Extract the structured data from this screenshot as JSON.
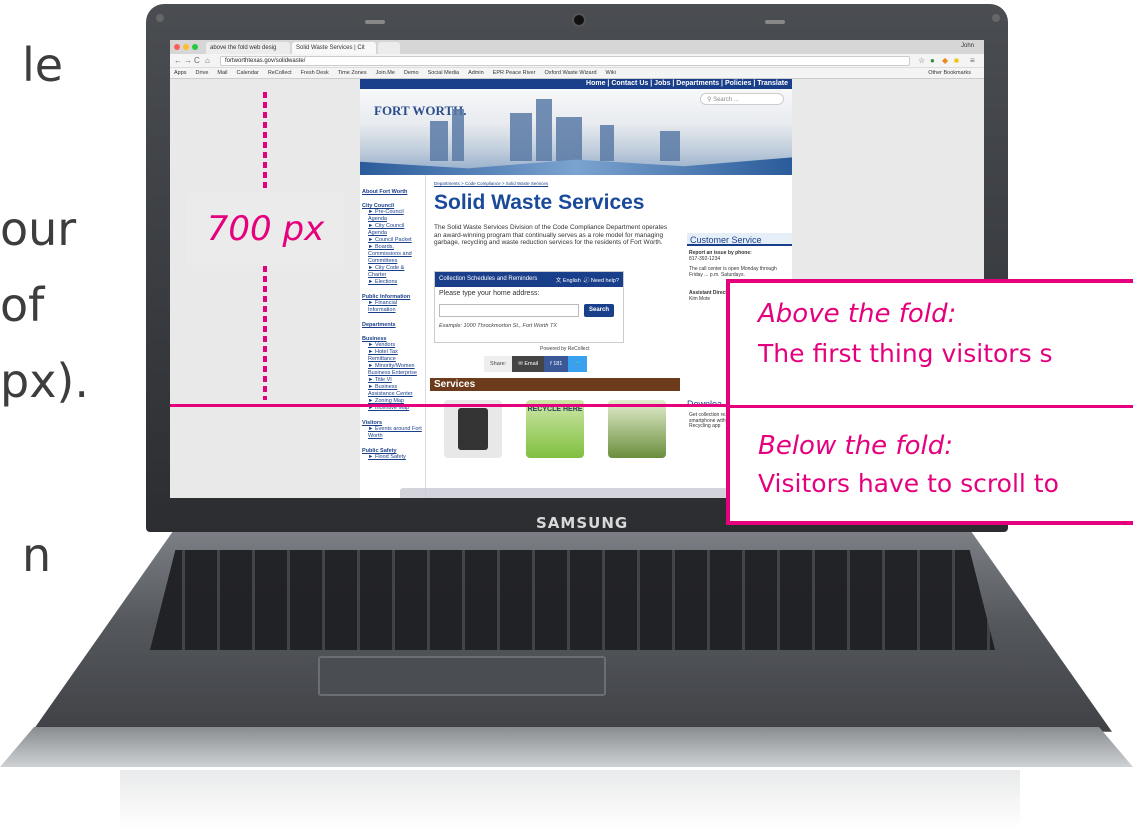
{
  "left_text": [
    "le",
    "our",
    "of",
    "px).",
    "n"
  ],
  "annotation": {
    "height_label": "700 px",
    "above_title": "Above the fold:",
    "above_body": "The first thing visitors s",
    "below_title": "Below the fold:",
    "below_body": "Visitors have to scroll to",
    "accent_color": "#e5007d"
  },
  "laptop": {
    "brand": "SAMSUNG"
  },
  "browser": {
    "tabs": [
      "above the fold web desig",
      "Solid Waste Services | Cit"
    ],
    "url": "fortworthtexas.gov/solidwaste/",
    "user": "John",
    "bookmarks": [
      "Apps",
      "Drive",
      "Mail",
      "Calendar",
      "ReCollect",
      "Fresh Desk",
      "Time Zones",
      "Join.Me",
      "Demo",
      "Social Media",
      "Admin",
      "EPR Peace River",
      "Oxford Waste Wizard",
      "Wiki"
    ],
    "other_bookmarks": "Other Bookmarks"
  },
  "site": {
    "topnav": "Home | Contact Us | Jobs | Departments | Policies | Translate",
    "logo": "FORT WORTH.",
    "search_placeholder": "Search ...",
    "breadcrumb": "Departments > Code Compliance > Solid Waste Services",
    "title": "Solid Waste Services",
    "description": "The Solid Waste Services Division of the Code Compliance Department operates an award-winning program that continually serves as a role model for managing garbage, recycling and waste reduction services for the residents of Fort Worth.",
    "sidebar": [
      {
        "heading": "About Fort Worth",
        "items": []
      },
      {
        "heading": "City Council",
        "items": [
          "Pre-Council Agenda",
          "City Council Agenda",
          "Council Packet",
          "Boards, Commissions and Committees",
          "City Code & Charter",
          "Elections"
        ]
      },
      {
        "heading": "Public Information",
        "items": [
          "Financial Information"
        ]
      },
      {
        "heading": "Departments",
        "items": []
      },
      {
        "heading": "Business",
        "items": [
          "Vendors",
          "Hotel Tax Remittance",
          "Minority/Women Business Enterprise",
          "Title VI",
          "Business Assistance Center",
          "Zoning Map",
          "Incentive Map"
        ]
      },
      {
        "heading": "Visitors",
        "items": [
          "Events around Fort Worth"
        ]
      },
      {
        "heading": "Public Safety",
        "items": [
          "Flood Safety"
        ]
      }
    ],
    "widget": {
      "header": "Collection Schedules and Reminders",
      "language": "English",
      "help": "Need help?",
      "label": "Please type your home address:",
      "button": "Search",
      "example": "Example: 1000 Throckmorton St., Fort Worth TX",
      "powered": "Powered by ReCollect"
    },
    "share": {
      "label": "Share:",
      "email": "Email",
      "fb_count": "181"
    },
    "services_heading": "Services",
    "services_recycle": "RECYCLE HERE",
    "right": {
      "heading": "Customer Service",
      "issue_label": "Report an issue by phone:",
      "phone": "817-392-1234",
      "call_center": "The call center is open Monday through Friday ... p.m. Saturdays.",
      "assistant": "Assistant Director",
      "assistant_name": "Kim Mote",
      "download": "Downloa",
      "download_text": "Get collection re... dispose of waste ... smartphone with ... City of Fort Worth ... & Recycling app"
    }
  }
}
